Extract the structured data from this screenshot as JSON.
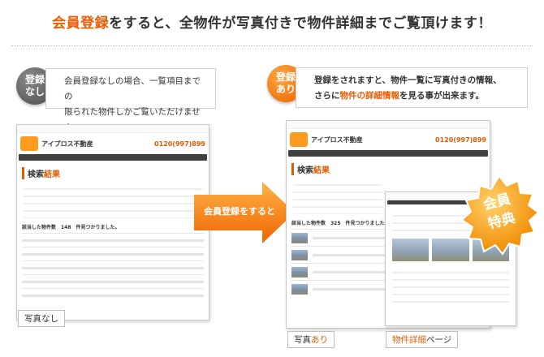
{
  "headline": {
    "highlight": "会員登録",
    "rest": "をすると、全物件が写真付きで物件詳細までご覧頂けます！"
  },
  "left_panel": {
    "badge_line1": "登録",
    "badge_line2": "なし",
    "note_line1": "会員登録なしの場合、一覧項目までの",
    "note_line2": "限られた物件しかご覧いただけません。",
    "caption": "写真なし"
  },
  "right_panel": {
    "badge_line1": "登録",
    "badge_line2": "あり",
    "note_line1": "登録をされますと、物件一覧に写真付きの情報、",
    "note_line2_pre": "さらに",
    "note_line2_hl": "物件の詳細情報",
    "note_line2_post": "を見る事が出来ます。",
    "caption_pre": "写真",
    "caption_hl": "あり",
    "caption2_hl": "物件詳細",
    "caption2_post": "ページ"
  },
  "arrow_label": "会員登録をすると",
  "member_badge": {
    "line1": "会員",
    "line2": "特典"
  },
  "mock_site": {
    "brand": "アイプロス不動産",
    "phone": "0120(997)899",
    "search_title_a": "検索",
    "search_title_b": "結果",
    "count_left": "該当した物件数　148　件見つかりました。",
    "count_right": "該当した物件数　325　件見つかりました。"
  },
  "colors": {
    "accent": "#f05a00",
    "gray_badge": "#5a5a5a",
    "orange_badge": "#f07800"
  }
}
